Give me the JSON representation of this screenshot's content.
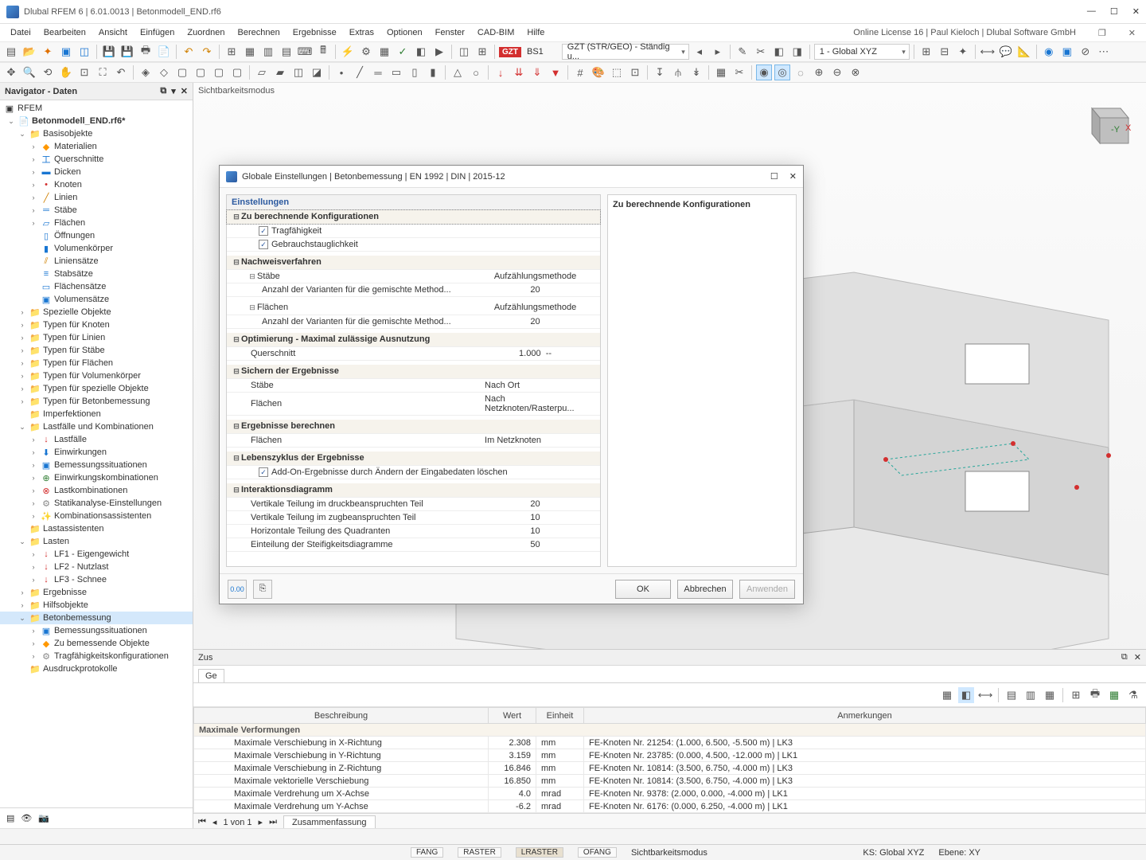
{
  "window": {
    "title": "Dlubal RFEM 6 | 6.01.0013 | Betonmodell_END.rf6"
  },
  "menu": {
    "items": [
      "Datei",
      "Bearbeiten",
      "Ansicht",
      "Einfügen",
      "Zuordnen",
      "Berechnen",
      "Ergebnisse",
      "Extras",
      "Optionen",
      "Fenster",
      "CAD-BIM",
      "Hilfe"
    ],
    "right": "Online License 16 | Paul Kieloch | Dlubal Software GmbH"
  },
  "tb1": {
    "gzt_badge": "GZT",
    "bs": "BS1",
    "combo": "GZT (STR/GEO) - Ständig u...",
    "coord": "1 - Global XYZ"
  },
  "nav": {
    "title": "Navigator - Daten",
    "root": "RFEM",
    "model": "Betonmodell_END.rf6*",
    "basis": "Basisobjekte",
    "basis_items": [
      "Materialien",
      "Querschnitte",
      "Dicken",
      "Knoten",
      "Linien",
      "Stäbe",
      "Flächen",
      "Öffnungen",
      "Volumenkörper",
      "Liniensätze",
      "Stabsätze",
      "Flächensätze",
      "Volumensätze"
    ],
    "typen": [
      "Spezielle Objekte",
      "Typen für Knoten",
      "Typen für Linien",
      "Typen für Stäbe",
      "Typen für Flächen",
      "Typen für Volumenkörper",
      "Typen für spezielle Objekte",
      "Typen für Betonbemessung",
      "Imperfektionen"
    ],
    "lfk": "Lastfälle und Kombinationen",
    "lfk_items": [
      "Lastfälle",
      "Einwirkungen",
      "Bemessungssituationen",
      "Einwirkungskombinationen",
      "Lastkombinationen",
      "Statikanalyse-Einstellungen",
      "Kombinationsassistenten"
    ],
    "lastass": "Lastassistenten",
    "lasten": "Lasten",
    "lasten_items": [
      "LF1 - Eigengewicht",
      "LF2 - Nutzlast",
      "LF3 - Schnee"
    ],
    "erg": "Ergebnisse",
    "hilf": "Hilfsobjekte",
    "beton": "Betonbemessung",
    "beton_items": [
      "Bemessungssituationen",
      "Zu bemessende Objekte",
      "Tragfähigkeitskonfigurationen"
    ],
    "ausdruck": "Ausdruckprotokolle"
  },
  "viewport": {
    "mode": "Sichtbarkeitsmodus"
  },
  "dialog": {
    "title": "Globale Einstellungen | Betonbemessung | EN 1992 | DIN | 2015-12",
    "left_hdr": "Einstellungen",
    "right_hdr": "Zu berechnende Konfigurationen",
    "g1": "Zu berechnende Konfigurationen",
    "g1a": "Tragfähigkeit",
    "g1b": "Gebrauchstauglichkeit",
    "g2": "Nachweisverfahren",
    "g2a": "Stäbe",
    "g2a_v": "Aufzählungsmethode",
    "g2a2": "Anzahl der Varianten für die gemischte Method...",
    "g2a2_v": "20",
    "g2b": "Flächen",
    "g2b_v": "Aufzählungsmethode",
    "g2b2": "Anzahl der Varianten für die gemischte Method...",
    "g2b2_v": "20",
    "g3": "Optimierung - Maximal zulässige Ausnutzung",
    "g3a": "Querschnitt",
    "g3a_v": "1.000",
    "g3a_u": "--",
    "g4": "Sichern der Ergebnisse",
    "g4a": "Stäbe",
    "g4a_v": "Nach Ort",
    "g4b": "Flächen",
    "g4b_v": "Nach Netzknoten/Rasterpu...",
    "g5": "Ergebnisse berechnen",
    "g5a": "Flächen",
    "g5a_v": "Im Netzknoten",
    "g6": "Lebenszyklus der Ergebnisse",
    "g6a": "Add-On-Ergebnisse durch Ändern der Eingabedaten löschen",
    "g7": "Interaktionsdiagramm",
    "g7a": "Vertikale Teilung im druckbeanspruchten Teil",
    "g7a_v": "20",
    "g7b": "Vertikale Teilung im zugbeanspruchten Teil",
    "g7b_v": "10",
    "g7c": "Horizontale Teilung des Quadranten",
    "g7c_v": "10",
    "g7d": "Einteilung der Steifigkeitsdiagramme",
    "g7d_v": "50",
    "ok": "OK",
    "cancel": "Abbrechen",
    "apply": "Anwenden"
  },
  "bp": {
    "hdr": "Zus",
    "tab": "Ge",
    "cols": [
      "Beschreibung",
      "Wert",
      "Einheit",
      "Anmerkungen"
    ],
    "grp": "Maximale Verformungen",
    "rows": [
      {
        "b": "Maximale Verschiebung in X-Richtung",
        "w": "2.308",
        "e": "mm",
        "a": "FE-Knoten Nr. 21254: (1.000, 6.500, -5.500 m) | LK3"
      },
      {
        "b": "Maximale Verschiebung in Y-Richtung",
        "w": "3.159",
        "e": "mm",
        "a": "FE-Knoten Nr. 23785: (0.000, 4.500, -12.000 m) | LK1"
      },
      {
        "b": "Maximale Verschiebung in Z-Richtung",
        "w": "16.846",
        "e": "mm",
        "a": "FE-Knoten Nr. 10814: (3.500, 6.750, -4.000 m) | LK3"
      },
      {
        "b": "Maximale vektorielle Verschiebung",
        "w": "16.850",
        "e": "mm",
        "a": "FE-Knoten Nr. 10814: (3.500, 6.750, -4.000 m) | LK3"
      },
      {
        "b": "Maximale Verdrehung um X-Achse",
        "w": "4.0",
        "e": "mrad",
        "a": "FE-Knoten Nr. 9378: (2.000, 0.000, -4.000 m) | LK1"
      },
      {
        "b": "Maximale Verdrehung um Y-Achse",
        "w": "-6.2",
        "e": "mrad",
        "a": "FE-Knoten Nr. 6176: (0.000, 6.250, -4.000 m) | LK1"
      }
    ],
    "pager": "1 von 1",
    "pager_tab": "Zusammenfassung"
  },
  "status": {
    "fang": "FANG",
    "raster": "RASTER",
    "lraster": "LRASTER",
    "ofang": "OFANG",
    "sicht": "Sichtbarkeitsmodus",
    "ks": "KS: Global XYZ",
    "ebene": "Ebene: XY"
  }
}
